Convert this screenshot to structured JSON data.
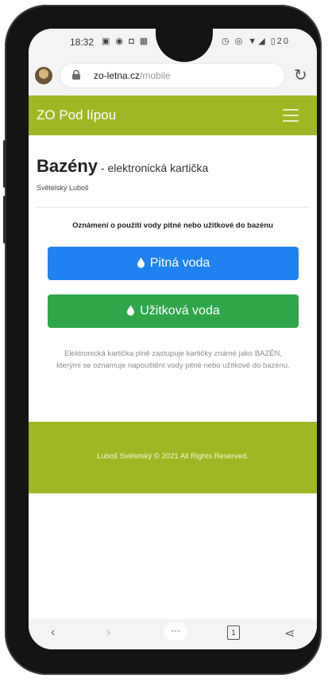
{
  "status_bar": {
    "time": "18:32",
    "left_icons": "▣ ◉ ◘ ▦",
    "right_icons": "◷ ◎ ▼◢ ▯20"
  },
  "browser": {
    "url_host": "zo-letna.cz",
    "url_path": "/mobile",
    "reload_icon": "reload-icon"
  },
  "navbar": {
    "brand": "ZO Pod lípou",
    "menu_icon": "hamburger-icon",
    "color": "#9fb725"
  },
  "page": {
    "title": "Bazény",
    "subtitle": " - elektronická kartička",
    "author": "Světelský Luboš",
    "notice": "Oznámení o použití vody pitné nebo užitkové do bazénu",
    "buttons": [
      {
        "label": "Pitná voda",
        "icon": "water-drop-icon",
        "color": "#1f82f2"
      },
      {
        "label": "Užitková voda",
        "icon": "water-drop-icon",
        "color": "#2fa64a"
      }
    ],
    "description": "Elektronická kartička plně zastupuje kartičky známé jako BAZÉN, kterými se oznamuje napouštění vody pitné nebo užitkové do bazénu."
  },
  "footer": {
    "copyright": "Luboš Světelský © 2021 All Rights Reserved."
  },
  "bottom_bar": {
    "back": "‹",
    "forward": "›",
    "home": "···",
    "tabs": "1",
    "share": "⋖"
  }
}
